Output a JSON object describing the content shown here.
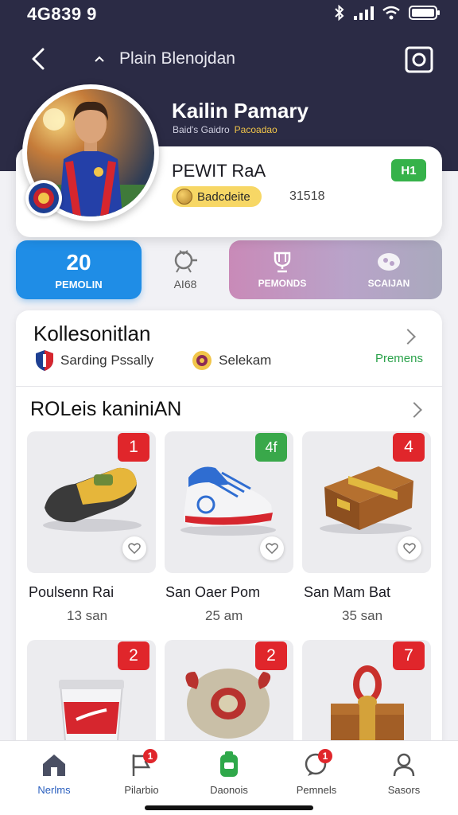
{
  "status_bar": {
    "time": "4G839 9"
  },
  "nav": {
    "title": "Plain Blenojdan"
  },
  "profile": {
    "name": "Kailin Pamary",
    "subtitle_1": "Baid's Gaidro",
    "subtitle_2": "Pacoadao",
    "card_title": "PEWIT RaA",
    "level": "H1",
    "badge_label": "Badcdeite",
    "badge_number": "31518"
  },
  "stats": [
    {
      "value": "20",
      "label": "PEMOLIN"
    },
    {
      "value": "",
      "label": "AI68"
    },
    {
      "value": "",
      "label": "PEMONDS"
    },
    {
      "value": "",
      "label": "SCAIJAN"
    }
  ],
  "collection": {
    "title": "Kollesonitlan",
    "items": [
      {
        "label": "Sarding Pssally"
      },
      {
        "label": "Selekam"
      }
    ],
    "premium_link": "Premens"
  },
  "roles": {
    "title": "ROLeis kaniniAN",
    "cards": [
      {
        "name": "Poulsenn Rai",
        "time": "13 san",
        "badge": "1",
        "badge_color": "#e0262b",
        "icon": "shoe-slipper-icon"
      },
      {
        "name": "San Oaer Pom",
        "time": "25 am",
        "badge": "4f",
        "badge_color": "#39a84a",
        "icon": "sneaker-icon"
      },
      {
        "name": "San Mam Bat",
        "time": "35 san",
        "badge": "4",
        "badge_color": "#e0262b",
        "icon": "treasure-chest-icon"
      },
      {
        "name": "",
        "time": "",
        "badge": "2",
        "badge_color": "#e0262b",
        "icon": "cup-icon"
      },
      {
        "name": "",
        "time": "",
        "badge": "2",
        "badge_color": "#e0262b",
        "icon": "pouch-icon"
      },
      {
        "name": "",
        "time": "",
        "badge": "7",
        "badge_color": "#e0262b",
        "icon": "gift-box-icon"
      }
    ]
  },
  "tab_bar": {
    "tabs": [
      {
        "label": "Nerlms",
        "icon": "home-icon",
        "active": true,
        "notif": ""
      },
      {
        "label": "Pilarbio",
        "icon": "flag-icon",
        "active": false,
        "notif": "1"
      },
      {
        "label": "Daonois",
        "icon": "bottle-icon",
        "active": false,
        "notif": ""
      },
      {
        "label": "Pemnels",
        "icon": "chat-icon",
        "active": false,
        "notif": "1"
      },
      {
        "label": "Sasors",
        "icon": "user-icon",
        "active": false,
        "notif": ""
      }
    ]
  },
  "colors": {
    "header": "#2b2b45",
    "primary_blue": "#1f8de6",
    "accent_green": "#36b24a",
    "badge_red": "#e0262b",
    "badge_yellow": "#f7d765"
  }
}
